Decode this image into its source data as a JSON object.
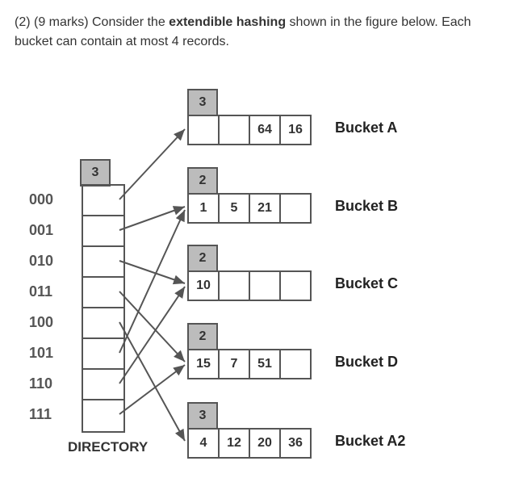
{
  "question": {
    "prefix": "(2) (9 marks) Consider the ",
    "bold": "extendible hashing",
    "suffix": " shown in the figure below. Each bucket can contain at most 4 records."
  },
  "directory": {
    "global_depth": "3",
    "labels": [
      "000",
      "001",
      "010",
      "011",
      "100",
      "101",
      "110",
      "111"
    ],
    "caption": "DIRECTORY"
  },
  "buckets": [
    {
      "name": "Bucket A",
      "depth": "3",
      "cells": [
        "",
        "",
        "64",
        "16"
      ]
    },
    {
      "name": "Bucket B",
      "depth": "2",
      "cells": [
        "1",
        "5",
        "21",
        ""
      ]
    },
    {
      "name": "Bucket C",
      "depth": "2",
      "cells": [
        "10",
        "",
        "",
        ""
      ]
    },
    {
      "name": "Bucket D",
      "depth": "2",
      "cells": [
        "15",
        "7",
        "51",
        ""
      ]
    },
    {
      "name": "Bucket A2",
      "depth": "3",
      "cells": [
        "4",
        "12",
        "20",
        "36"
      ]
    }
  ]
}
